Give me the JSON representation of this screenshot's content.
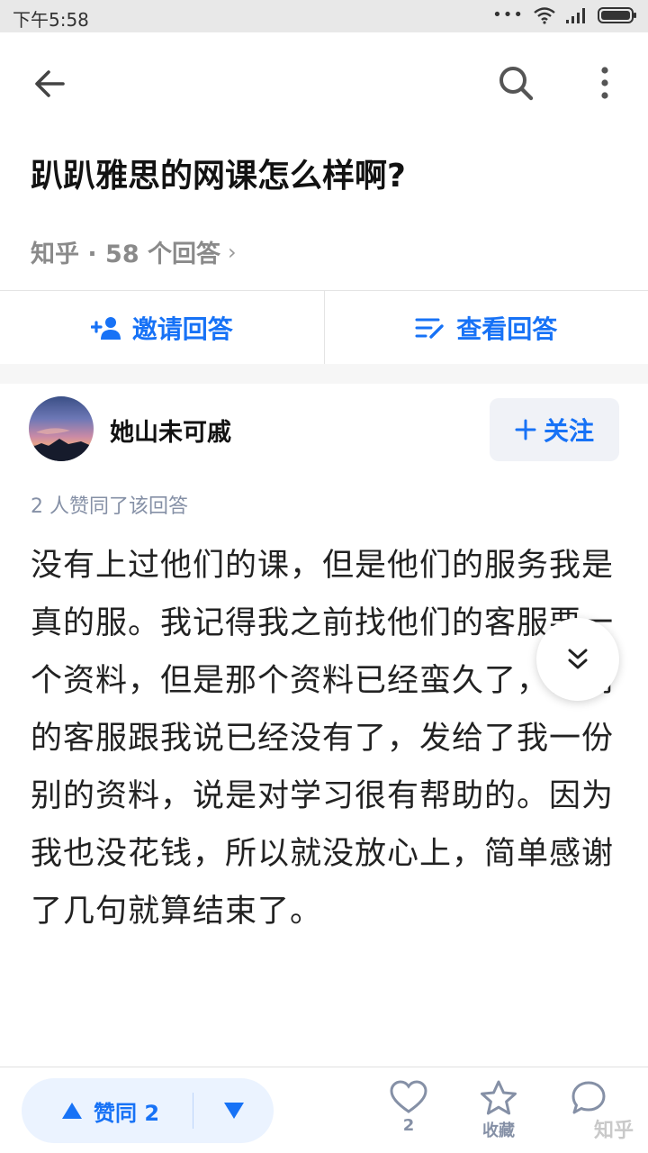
{
  "status_bar": {
    "time": "下午5:58",
    "dots": "•••"
  },
  "question": {
    "title": "趴趴雅思的网课怎么样啊?",
    "meta": "知乎 · 58 个回答",
    "chevron": "›"
  },
  "actions": {
    "invite": "邀请回答",
    "view": "查看回答"
  },
  "author": {
    "name": "她山未可戚",
    "follow": "关注"
  },
  "answer": {
    "approvals": "2 人赞同了该回答",
    "text": "没有上过他们的课，但是他们的服务我是真的服。我记得我之前找他们的客服要一个资料，但是那个资料已经蛮久了，他们的客服跟我说已经没有了，发给了我一份别的资料，说是对学习很有帮助的。因为我也没花钱，所以就没放心上，简单感谢了几句就算结束了。"
  },
  "bottom_bar": {
    "vote_label": "赞同 2",
    "like_count": "2",
    "collect_label": "收藏",
    "watermark": "知乎"
  },
  "colors": {
    "accent": "#1772f6",
    "muted": "#8590a6"
  },
  "icons": [
    "back-arrow-icon",
    "search-icon",
    "more-vertical-icon",
    "add-person-icon",
    "list-edit-icon",
    "plus-icon",
    "double-chevron-down-icon",
    "triangle-up-icon",
    "triangle-down-icon",
    "heart-icon",
    "star-icon",
    "comment-icon"
  ]
}
